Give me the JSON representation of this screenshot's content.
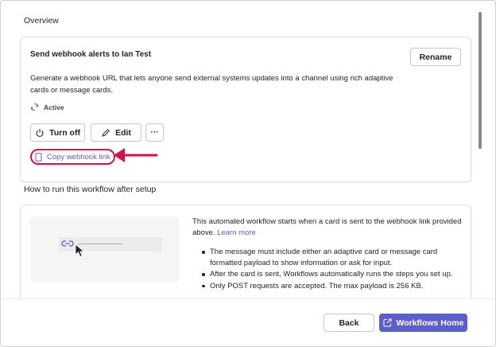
{
  "overview": {
    "section_title": "Overview",
    "card_title": "Send webhook alerts to Ian Test",
    "rename_label": "Rename",
    "description": "Generate a webhook URL that lets anyone send external systems updates into a channel using rich adaptive cards or message cards.",
    "status": "Active",
    "turn_off_label": "Turn off",
    "edit_label": "Edit",
    "more_label": "···",
    "copy_link_label": "Copy webhook link",
    "highlight_color": "#d4114a"
  },
  "how_to": {
    "section_title": "How to run this workflow after setup",
    "intro": "This automated workflow starts when a card is sent to the webhook link provided above.",
    "learn_more": "Learn more",
    "bullets": [
      "The message must include either an adaptive card or message card formatted payload to show information or ask for input.",
      "After the card is sent, Workflows automatically runs the steps you set up.",
      "Only POST requests are accepted. The max payload is 256 KB."
    ]
  },
  "footer": {
    "back_label": "Back",
    "home_label": "Workflows Home"
  },
  "colors": {
    "accent": "#5b5fc7",
    "highlight": "#d4114a"
  }
}
